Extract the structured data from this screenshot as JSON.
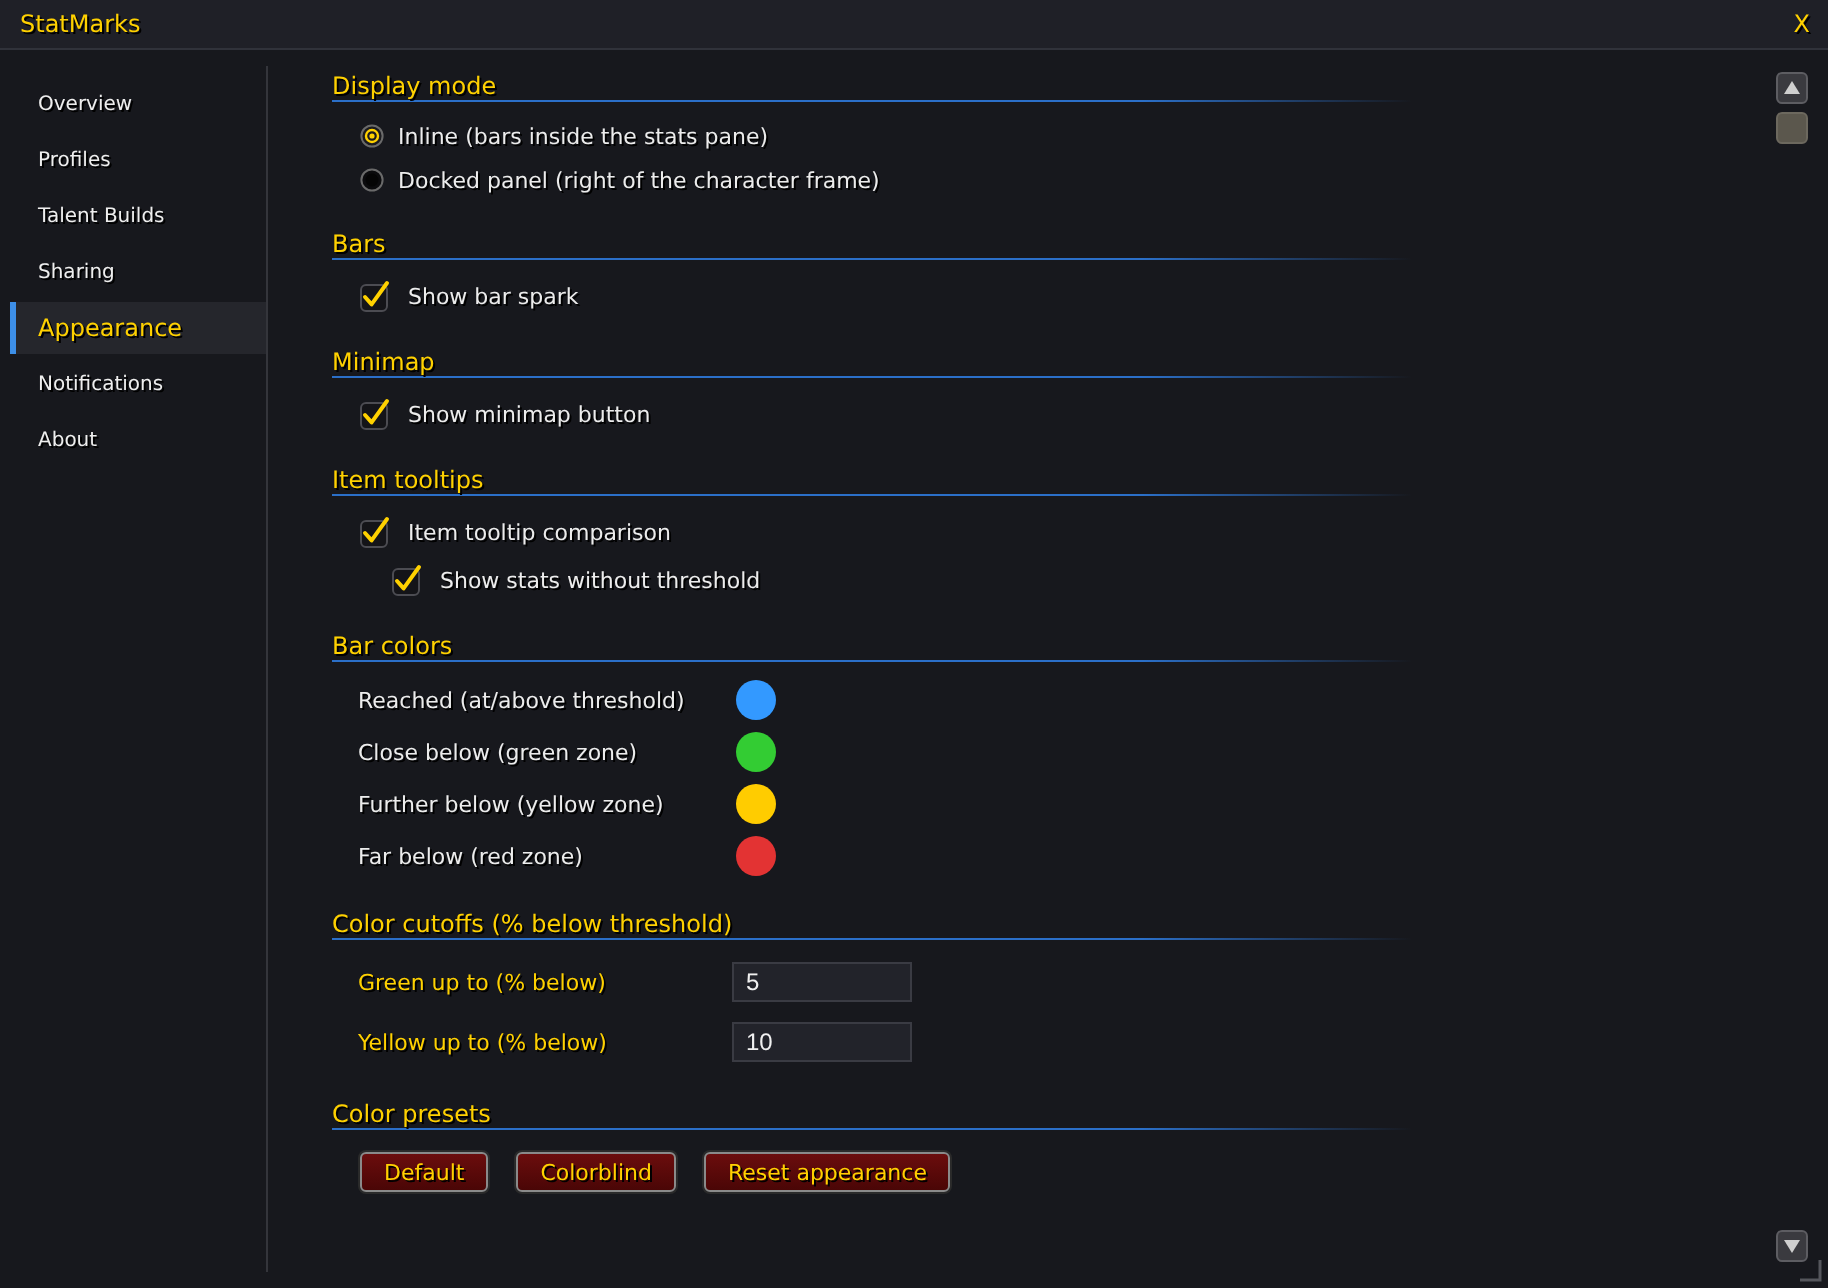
{
  "window": {
    "title": "StatMarks",
    "close": "X"
  },
  "sidebar": {
    "items": [
      {
        "label": "Overview",
        "selected": false
      },
      {
        "label": "Profiles",
        "selected": false
      },
      {
        "label": "Talent Builds",
        "selected": false
      },
      {
        "label": "Sharing",
        "selected": false
      },
      {
        "label": "Appearance",
        "selected": true
      },
      {
        "label": "Notifications",
        "selected": false
      },
      {
        "label": "About",
        "selected": false
      }
    ]
  },
  "sections": [
    {
      "title": "Display mode",
      "rows": [
        {
          "kind": "radio",
          "label": "Inline (bars inside the stats pane)",
          "selected": true
        },
        {
          "kind": "radio",
          "label": "Docked panel (right of the character frame)",
          "selected": false
        }
      ]
    },
    {
      "title": "Bars",
      "rows": [
        {
          "kind": "checkbox",
          "label": "Show bar spark",
          "checked": true
        }
      ]
    },
    {
      "title": "Minimap",
      "rows": [
        {
          "kind": "checkbox",
          "label": "Show minimap button",
          "checked": true
        }
      ]
    },
    {
      "title": "Item tooltips",
      "rows": [
        {
          "kind": "checkbox",
          "label": "Item tooltip comparison",
          "checked": true,
          "children": [
            {
              "kind": "checkbox",
              "label": "Show stats without threshold",
              "checked": true
            }
          ]
        }
      ]
    },
    {
      "title": "Bar colors",
      "rows": [
        {
          "kind": "color",
          "label": "Reached (at/above threshold)",
          "color": "#3399ff"
        },
        {
          "kind": "color",
          "label": "Close below (green zone)",
          "color": "#33cc33"
        },
        {
          "kind": "color",
          "label": "Further below (yellow zone)",
          "color": "#ffcc00"
        },
        {
          "kind": "color",
          "label": "Far below (red zone)",
          "color": "#e33333"
        }
      ]
    },
    {
      "title": "Color cutoffs (% below threshold)",
      "rows": [
        {
          "kind": "number",
          "label": "Green up to (% below)",
          "value": "5"
        },
        {
          "kind": "number",
          "label": "Yellow up to (% below)",
          "value": "10"
        }
      ]
    },
    {
      "title": "Color presets",
      "rows": [
        {
          "kind": "buttons",
          "buttons": [
            {
              "label": "Default"
            },
            {
              "label": "Colorblind"
            },
            {
              "label": "Reset appearance"
            }
          ]
        }
      ]
    }
  ]
}
